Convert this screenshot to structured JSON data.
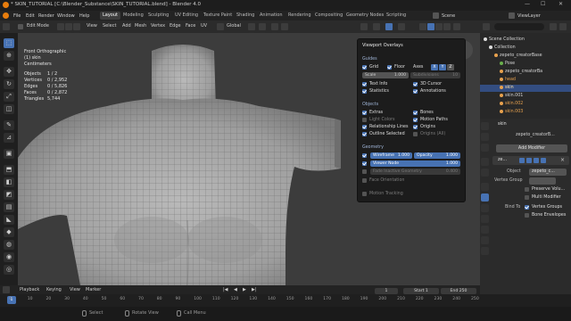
{
  "window": {
    "title": "* SKIN_TUTORIAL [C:\\Blender_Substance\\SKIN_TUTORIAL.blend] - Blender 4.0",
    "controls": [
      "—",
      "☐",
      "✕"
    ]
  },
  "menubar": {
    "menus": [
      "File",
      "Edit",
      "Render",
      "Window",
      "Help"
    ],
    "workspaces": [
      "Layout",
      "Modeling",
      "Sculpting",
      "UV Editing",
      "Texture Paint",
      "Shading",
      "Animation",
      "Rendering",
      "Compositing",
      "Geometry Nodes",
      "Scripting"
    ],
    "active_workspace": "Layout",
    "scene": "Scene",
    "view_layer": "ViewLayer"
  },
  "viewport_header": {
    "mode": "Edit Mode",
    "menus": [
      "View",
      "Select",
      "Add",
      "Mesh",
      "Vertex",
      "Edge",
      "Face",
      "UV"
    ],
    "transform": "Global"
  },
  "viewport_info": {
    "view": "Front Orthographic",
    "object": "(1) skin",
    "units": "Centimeters",
    "stats": [
      {
        "label": "Objects",
        "value": "1 / 2"
      },
      {
        "label": "Vertices",
        "value": "0 / 2,952"
      },
      {
        "label": "Edges",
        "value": "0 / 5,826"
      },
      {
        "label": "Faces",
        "value": "0 / 2,872"
      },
      {
        "label": "Triangles",
        "value": "5,744"
      }
    ]
  },
  "overlays": {
    "title": "Viewport Overlays",
    "guides": {
      "heading": "Guides",
      "grid": "Grid",
      "floor": "Floor",
      "axes": "Axes",
      "axis_x": "X",
      "axis_y": "Y",
      "axis_z": "Z",
      "scale_label": "Scale",
      "scale_value": "1.000",
      "subdivisions_label": "Subdivisions",
      "subdivisions_value": "10",
      "text_info": "Text Info",
      "cursor_3d": "3D Cursor",
      "statistics": "Statistics",
      "annotations": "Annotations"
    },
    "objects": {
      "heading": "Objects",
      "extras": "Extras",
      "bones": "Bones",
      "light_colors": "Light Colors",
      "motion_paths": "Motion Paths",
      "relationship_lines": "Relationship Lines",
      "origins": "Origins",
      "outline_selected": "Outline Selected",
      "origins_all": "Origins (All)"
    },
    "geometry": {
      "heading": "Geometry",
      "wireframe_label": "Wireframe",
      "wireframe_value": "1.000",
      "opacity_label": "Opacity",
      "opacity_value": "1.000",
      "fade_label": "Fade Inactive Geometry",
      "fade_value": "0.400",
      "face_orientation": "Face Orientation"
    },
    "motion_tracking": "Motion Tracking"
  },
  "outliner": {
    "rows": [
      {
        "label": "Scene Collection",
        "selected": false,
        "indent": 0
      },
      {
        "label": "Collection",
        "selected": false,
        "indent": 1
      },
      {
        "label": "zepeto_creatorBase",
        "selected": false,
        "indent": 2
      },
      {
        "label": "Pose",
        "selected": false,
        "indent": 3
      },
      {
        "label": "zepeto_creatorBa",
        "selected": false,
        "indent": 3
      },
      {
        "label": "head",
        "selected": false,
        "indent": 3
      },
      {
        "label": "skin",
        "selected": true,
        "indent": 3
      },
      {
        "label": "skin.001",
        "selected": false,
        "indent": 3
      },
      {
        "label": "skin.002",
        "selected": false,
        "indent": 3
      },
      {
        "label": "skin.003",
        "selected": false,
        "indent": 3
      }
    ]
  },
  "properties": {
    "object_name": "skin",
    "modifier_path": "zepeto_creatorB...",
    "add_modifier": "Add Modifier",
    "modifier_name": "ze...",
    "object_label": "Object",
    "object_value": "zepeto_c...",
    "vertex_group_label": "Vertex Group",
    "preserve_volume": "Preserve Volu...",
    "multi_modifier": "Multi Modifier",
    "bind_to": "Bind To",
    "vertex_groups": "Vertex Groups",
    "bone_envelopes": "Bone Envelopes"
  },
  "timeline": {
    "menus": [
      "Playback",
      "Keying",
      "View",
      "Marker"
    ],
    "current_frame": "1",
    "start_label": "Start",
    "start_value": "1",
    "end_label": "End",
    "end_value": "250",
    "ticks": [
      "0",
      "10",
      "20",
      "30",
      "40",
      "50",
      "60",
      "70",
      "80",
      "90",
      "100",
      "110",
      "120",
      "130",
      "140",
      "150",
      "160",
      "170",
      "180",
      "190",
      "200",
      "210",
      "220",
      "230",
      "240",
      "250"
    ]
  },
  "status": {
    "left": "Select",
    "middle": "Rotate View",
    "right": "Call Menu"
  },
  "colors": {
    "accent": "#4772b3",
    "viewport_bg": "#3c3c3c",
    "panel_bg": "#1c1c1c"
  }
}
